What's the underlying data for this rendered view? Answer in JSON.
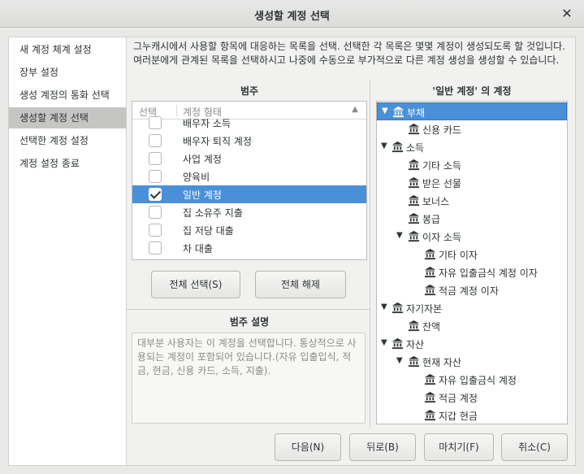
{
  "window": {
    "title": "생성할 계정 선택"
  },
  "sidebar": {
    "items": [
      {
        "label": "새 계정 체계 설정"
      },
      {
        "label": "장부 설정"
      },
      {
        "label": "생성 계정의 통화 선택"
      },
      {
        "label": "생성할 계정 선택"
      },
      {
        "label": "선택한 계정 설정"
      },
      {
        "label": "계정 설정 종료"
      }
    ],
    "active_index": 3
  },
  "intro": {
    "text": "그누캐시에서 사용할 항목에 대응하는 목록을 선택. 선택한 각 목록은 몇몇 계정이 생성되도록 할 것입니다. 여러분에게 관계된 목록을 선택하시고 나중에 수동으로 부가적으로 다른 계정 생성을 생성할 수 있습니다."
  },
  "categories": {
    "header": "범주",
    "col_select": "선택",
    "col_type": "계정 형태",
    "rows": [
      {
        "label": "배우자 소득",
        "checked": false
      },
      {
        "label": "배우자 퇴직 계정",
        "checked": false
      },
      {
        "label": "사업 계정",
        "checked": false
      },
      {
        "label": "양육비",
        "checked": false
      },
      {
        "label": "일반 계정",
        "checked": true
      },
      {
        "label": "집 소유주 지출",
        "checked": false
      },
      {
        "label": "집 저당 대출",
        "checked": false
      },
      {
        "label": "차 대출",
        "checked": false
      }
    ],
    "selected_index": 4,
    "select_all_label": "전체 선택(S)",
    "clear_all_label": "전체 해제"
  },
  "description": {
    "header": "범주 설명",
    "text": "대부분 사용자는 이 계정을 선택합니다. 통상적으로 사용되는 계정이 포함되어 있습니다.(자유 입출입식, 적금, 현금, 신용 카드, 소득, 지출)."
  },
  "accounts": {
    "header": "'일반 계정' 의 계정",
    "tree": [
      {
        "label": "부채",
        "level": 0,
        "expanded": true
      },
      {
        "label": "신용 카드",
        "level": 1
      },
      {
        "label": "소득",
        "level": 0,
        "expanded": true
      },
      {
        "label": "기타 소득",
        "level": 1
      },
      {
        "label": "받은 선물",
        "level": 1
      },
      {
        "label": "보너스",
        "level": 1
      },
      {
        "label": "봉급",
        "level": 1
      },
      {
        "label": "이자 소득",
        "level": 1,
        "expanded": true
      },
      {
        "label": "기타 이자",
        "level": 2
      },
      {
        "label": "자유 입출금식 계정 이자",
        "level": 2
      },
      {
        "label": "적금 계정 이자",
        "level": 2
      },
      {
        "label": "자기자본",
        "level": 0,
        "expanded": true
      },
      {
        "label": "잔액",
        "level": 1
      },
      {
        "label": "자산",
        "level": 0,
        "expanded": true
      },
      {
        "label": "현재 자산",
        "level": 1,
        "expanded": true
      },
      {
        "label": "자유 입출금식 계정",
        "level": 2
      },
      {
        "label": "적금 계정",
        "level": 2
      },
      {
        "label": "지갑 현금",
        "level": 2
      }
    ],
    "selected_index": 0
  },
  "footer": {
    "next_label": "다음(N)",
    "back_label": "뒤로(B)",
    "finish_label": "마치기(F)",
    "cancel_label": "취소(C)"
  },
  "colors": {
    "accent": "#4a90d9"
  }
}
